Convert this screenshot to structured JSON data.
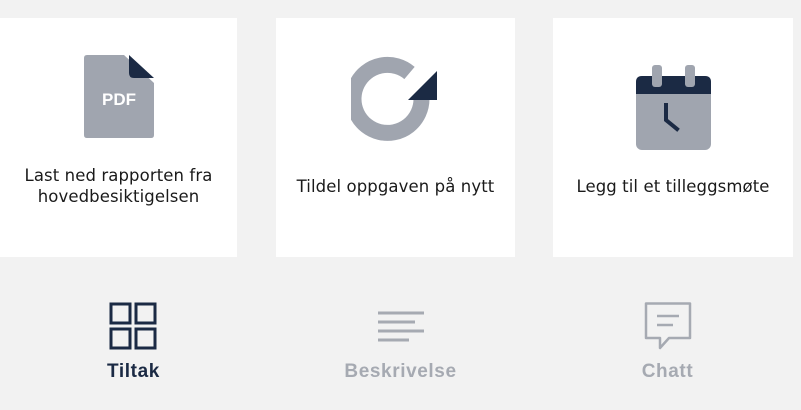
{
  "colors": {
    "background": "#f2f2f2",
    "card": "#ffffff",
    "navy": "#1b2a44",
    "gray_icon": "#a0a5af",
    "inactive_text": "#a6aab2"
  },
  "actions": [
    {
      "icon": "pdf-file-icon",
      "pdf_text": "PDF",
      "label": "Last ned rapporten fra hovedbesiktigelsen"
    },
    {
      "icon": "reassign-refresh-icon",
      "label": "Tildel oppgaven på nytt"
    },
    {
      "icon": "calendar-icon",
      "label": "Legg til et tilleggsmøte"
    }
  ],
  "tabs": [
    {
      "icon": "grid-icon",
      "label": "Tiltak",
      "active": true
    },
    {
      "icon": "text-lines-icon",
      "label": "Beskrivelse",
      "active": false
    },
    {
      "icon": "chat-bubble-icon",
      "label": "Chatt",
      "active": false
    }
  ]
}
